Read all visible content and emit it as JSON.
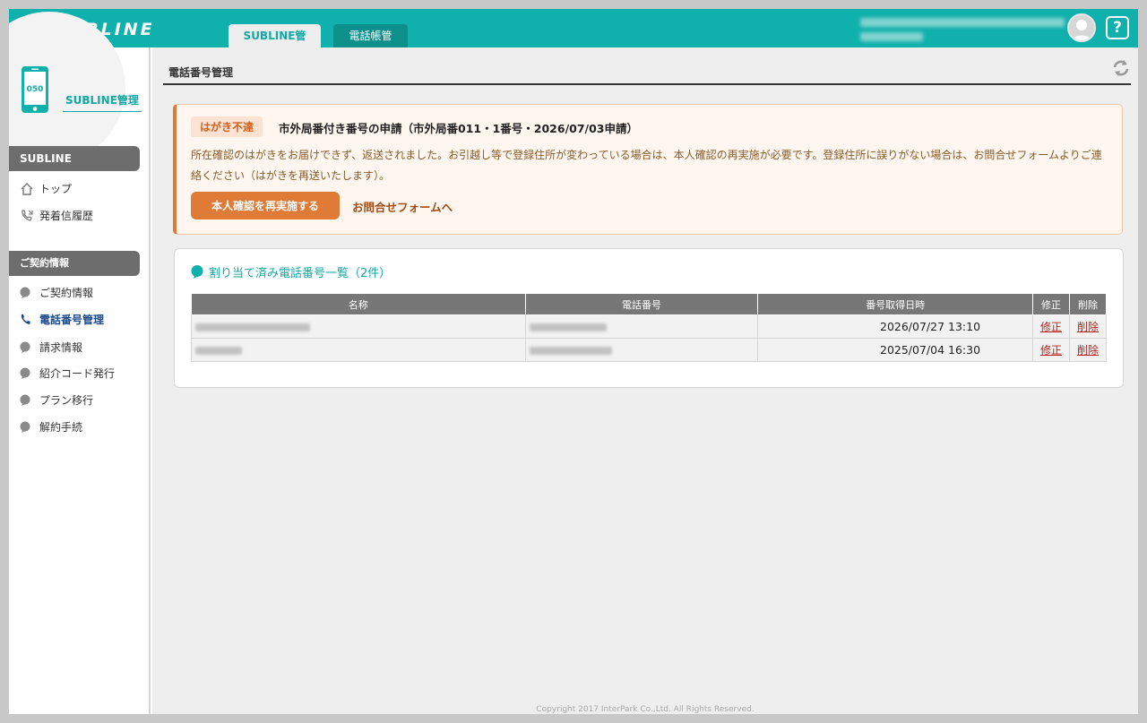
{
  "header": {
    "logo_text": "SUBLINE",
    "tabs": [
      {
        "label": "SUBLINE管理",
        "active": true
      },
      {
        "label": "電話帳管理",
        "active": false
      }
    ],
    "help_label": "?",
    "colors": {
      "brand": "#10b0ac",
      "accent": "#e07a37"
    }
  },
  "sidebar": {
    "phone_badge": "050",
    "title": "SUBLINE管理",
    "sections": [
      {
        "header": "SUBLINE",
        "items": [
          {
            "label": "トップ",
            "icon": "home-icon"
          },
          {
            "label": "発着信履歴",
            "icon": "phone-arrow-icon"
          }
        ]
      },
      {
        "header": "ご契約情報",
        "items": [
          {
            "label": "ご契約情報",
            "icon": "bullet-icon"
          },
          {
            "label": "電話番号管理",
            "icon": "phone-icon",
            "active": true
          },
          {
            "label": "請求情報",
            "icon": "bullet-icon"
          },
          {
            "label": "紹介コード発行",
            "icon": "bullet-icon"
          },
          {
            "label": "プラン移行",
            "icon": "bullet-icon"
          },
          {
            "label": "解約手続",
            "icon": "bullet-icon"
          }
        ]
      }
    ]
  },
  "main": {
    "page_title": "電話番号管理",
    "alert": {
      "badge": "はがき不達",
      "title": "市外局番付き番号の申請（市外局番011・1番号・2026/07/03申請）",
      "body": "所在確認のはがきをお届けできず、返送されました。お引越し等で登録住所が変わっている場合は、本人確認の再実施が必要です。登録住所に誤りがない場合は、お問合せフォームよりご連絡ください（はがきを再送いたします）。",
      "primary_button": "本人確認を再実施する",
      "link": "お問合せフォームへ"
    },
    "numbers": {
      "title": "割り当て済み電話番号一覧（2件）",
      "columns": [
        "名称",
        "電話番号",
        "番号取得日時",
        "修正",
        "削除"
      ],
      "rows": [
        {
          "acquired": "2026/07/27 13:10",
          "edit": "修正",
          "delete": "削除"
        },
        {
          "acquired": "2025/07/04 16:30",
          "edit": "修正",
          "delete": "削除"
        }
      ]
    }
  },
  "footer": {
    "copyright": "Copyright 2017 InterPark Co.,Ltd. All Rights Reserved."
  }
}
